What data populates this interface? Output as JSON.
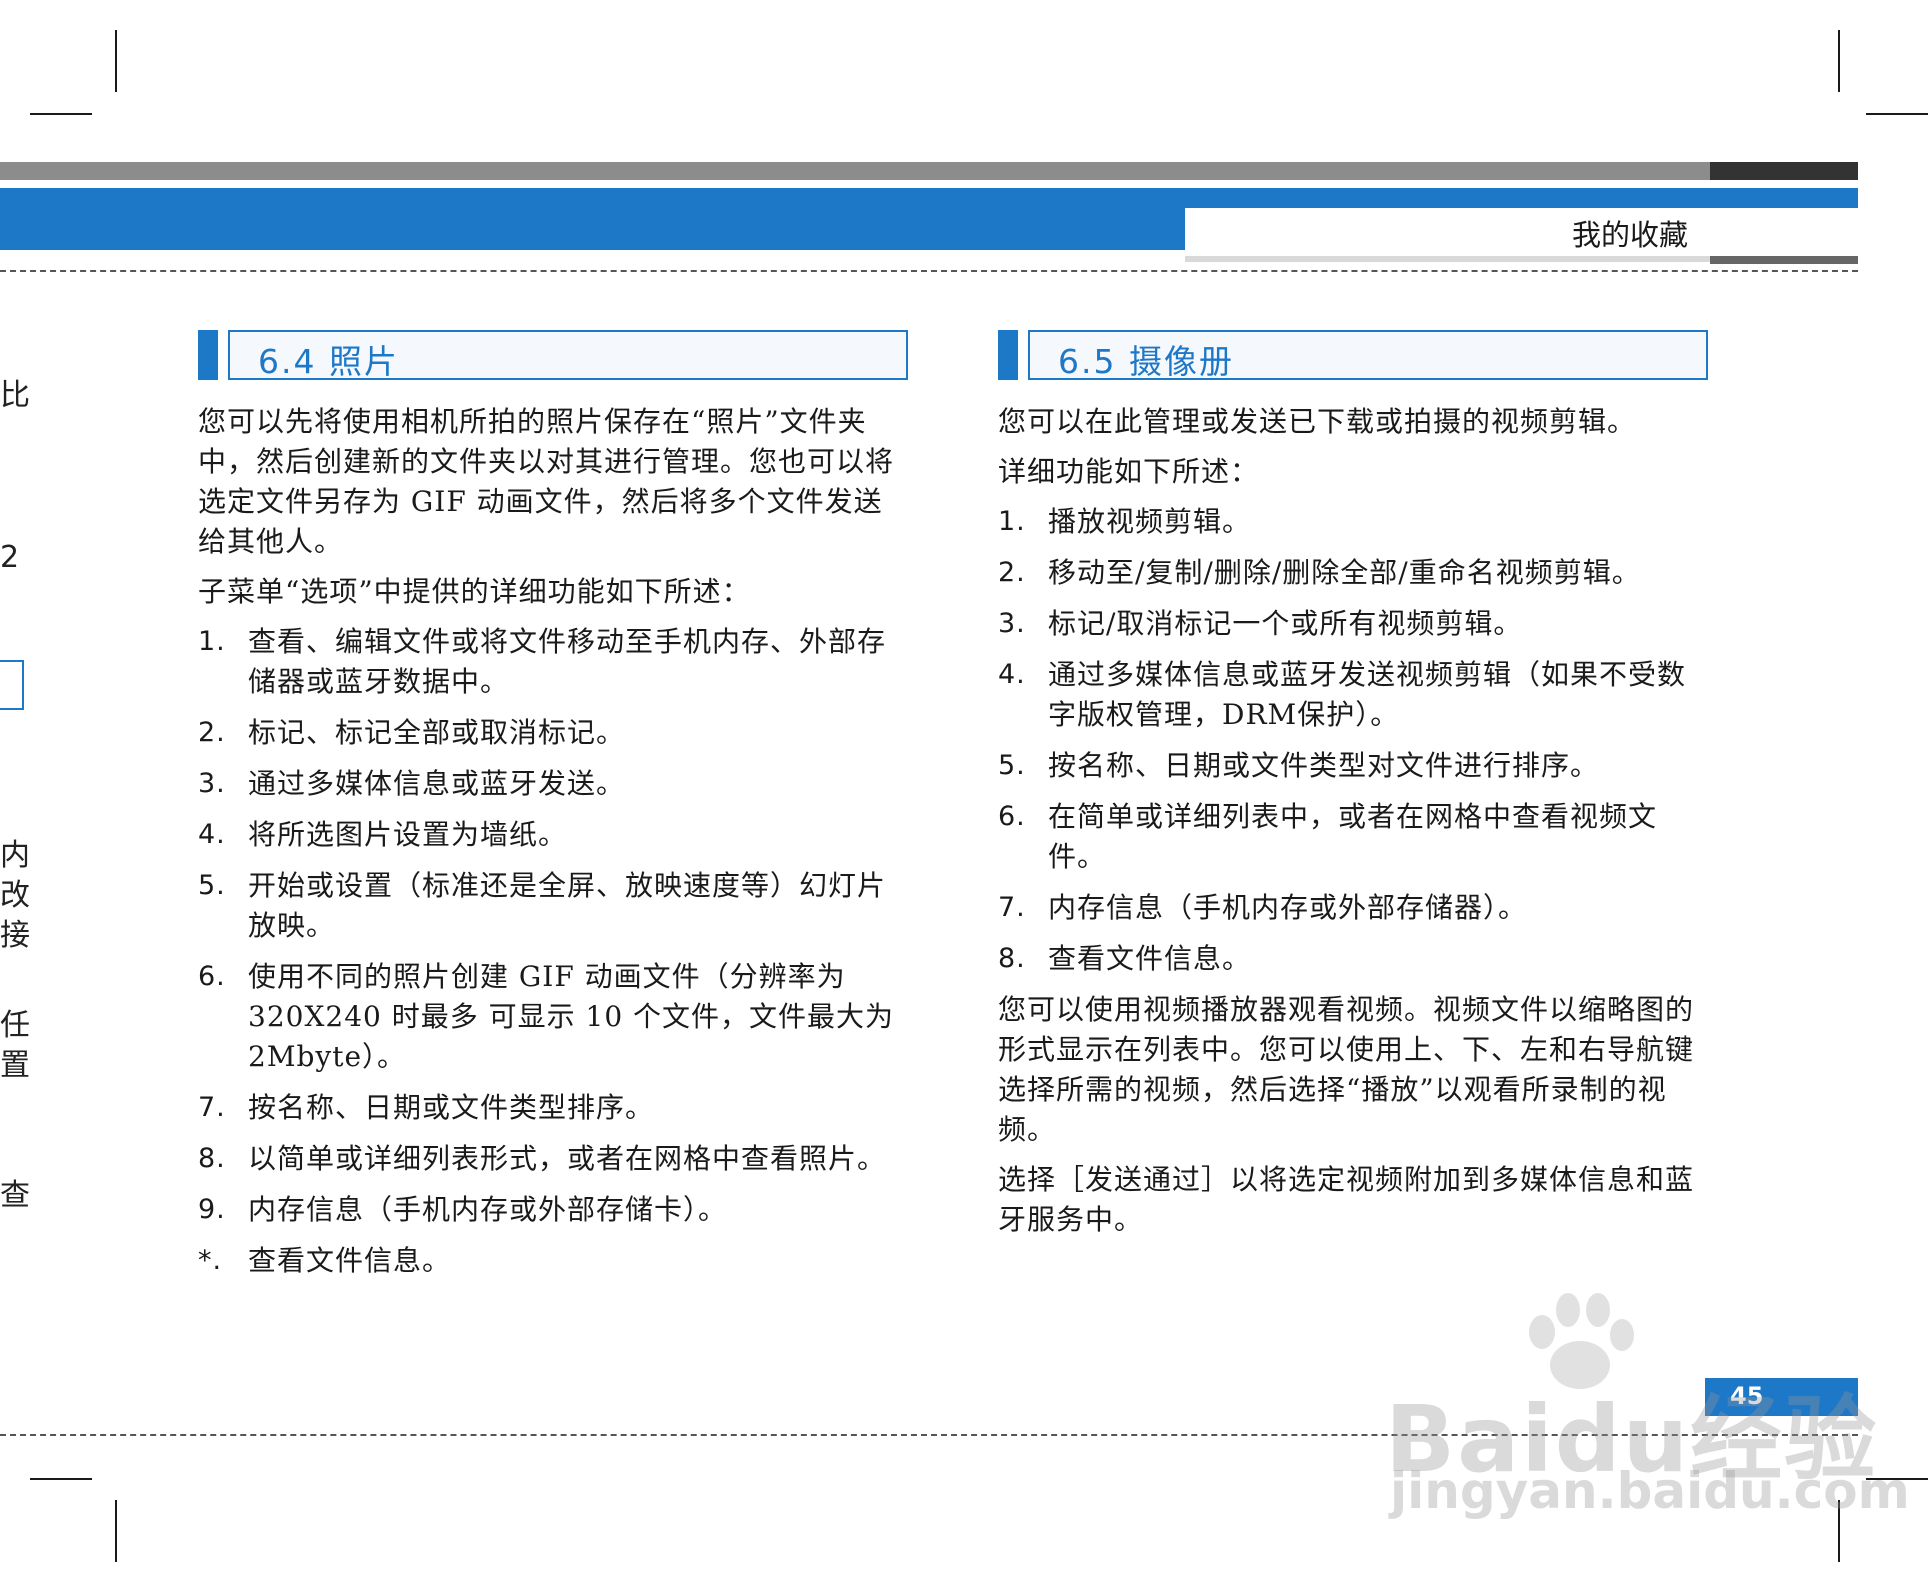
{
  "header": {
    "title": "我的收藏"
  },
  "left_remnants": [
    "比",
    "2",
    "内",
    "改",
    "接",
    "任",
    "置",
    "查"
  ],
  "left_section": {
    "title": "6.4 照片",
    "paragraphs": [
      "您可以先将使用相机所拍的照片保存在“照片”文件夹中，然后创建新的文件夹以对其进行管理。您也可以将选定文件另存为 GIF 动画文件，然后将多个文件发送给其他人。",
      "子菜单“选项”中提供的详细功能如下所述："
    ],
    "items": [
      {
        "num": "1.",
        "text": "查看、编辑文件或将文件移动至手机内存、外部存储器或蓝牙数据中。"
      },
      {
        "num": "2.",
        "text": "标记、标记全部或取消标记。"
      },
      {
        "num": "3.",
        "text": "通过多媒体信息或蓝牙发送。"
      },
      {
        "num": "4.",
        "text": "将所选图片设置为墙纸。"
      },
      {
        "num": "5.",
        "text": "开始或设置（标准还是全屏、放映速度等）幻灯片放映。"
      },
      {
        "num": "6.",
        "text": "使用不同的照片创建 GIF 动画文件（分辨率为 320X240 时最多 可显示 10 个文件，文件最大为 2Mbyte）。"
      },
      {
        "num": "7.",
        "text": "按名称、日期或文件类型排序。"
      },
      {
        "num": "8.",
        "text": "以简单或详细列表形式，或者在网格中查看照片。"
      },
      {
        "num": "9.",
        "text": "内存信息（手机内存或外部存储卡）。"
      },
      {
        "num": "*.",
        "text": "查看文件信息。"
      }
    ]
  },
  "right_section": {
    "title": "6.5 摄像册",
    "paragraphs_top": [
      "您可以在此管理或发送已下载或拍摄的视频剪辑。",
      "详细功能如下所述："
    ],
    "items": [
      {
        "num": "1.",
        "text": "播放视频剪辑。"
      },
      {
        "num": "2.",
        "text": "移动至/复制/删除/删除全部/重命名视频剪辑。"
      },
      {
        "num": "3.",
        "text": "标记/取消标记一个或所有视频剪辑。"
      },
      {
        "num": "4.",
        "text": "通过多媒体信息或蓝牙发送视频剪辑（如果不受数字版权管理，DRM保护）。"
      },
      {
        "num": "5.",
        "text": "按名称、日期或文件类型对文件进行排序。"
      },
      {
        "num": "6.",
        "text": "在简单或详细列表中，或者在网格中查看视频文件。"
      },
      {
        "num": "7.",
        "text": "内存信息（手机内存或外部存储器）。"
      },
      {
        "num": "8.",
        "text": "查看文件信息。"
      }
    ],
    "paragraphs_bottom": [
      "您可以使用视频播放器观看视频。视频文件以缩略图的形式显示在列表中。您可以使用上、下、左和右导航键选择所需的视频，然后选择“播放”以观看所录制的视频。",
      "选择［发送通过］以将选定视频附加到多媒体信息和蓝牙服务中。"
    ]
  },
  "page_number": "45",
  "watermark": {
    "line1": "Baidu经验",
    "line2": "jingyan.baidu.com"
  },
  "colors": {
    "accent": "#1e78c8",
    "gray": "#8c8c8c",
    "text": "#1a1a1a"
  }
}
